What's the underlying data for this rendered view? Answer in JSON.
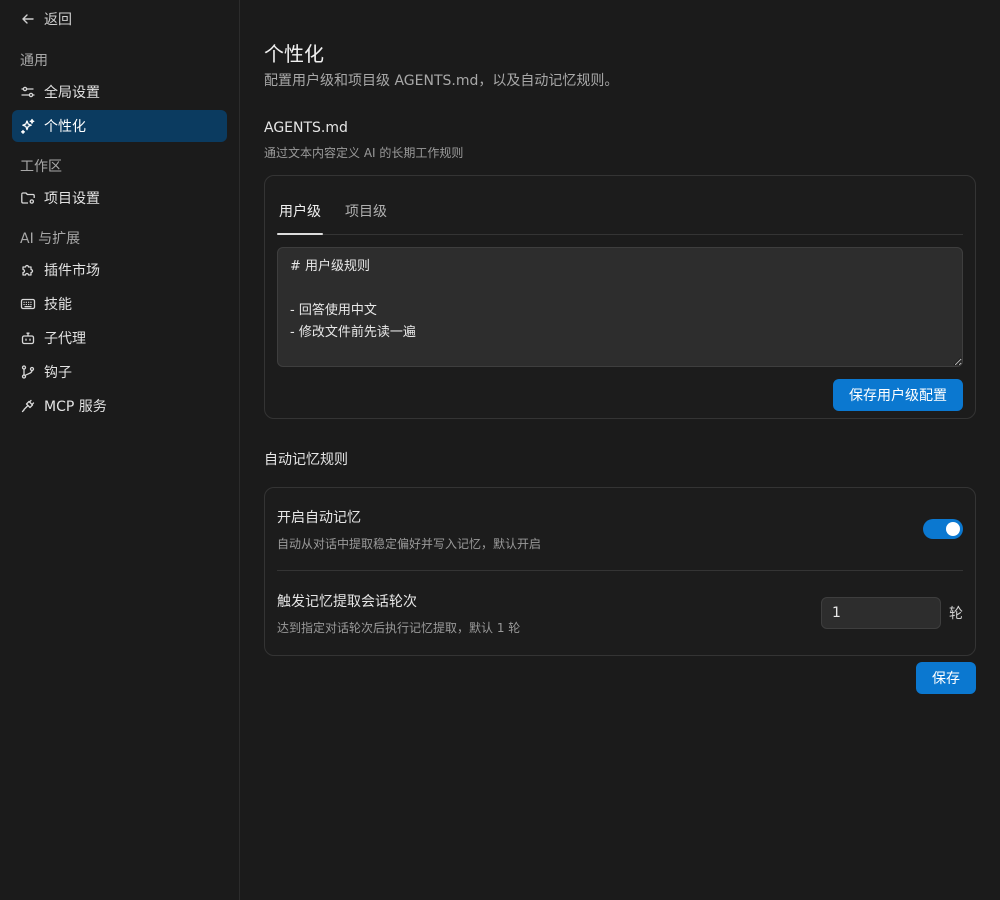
{
  "sidebar": {
    "back_label": "返回",
    "sections": {
      "general": "通用",
      "workspace": "工作区",
      "ai": "AI 与扩展"
    },
    "items": {
      "global_settings": "全局设置",
      "personalization": "个性化",
      "project_settings": "项目设置",
      "plugin_market": "插件市场",
      "skills": "技能",
      "sub_agents": "子代理",
      "hooks": "钩子",
      "mcp": "MCP 服务"
    },
    "active_item": "personalization"
  },
  "page": {
    "title": "个性化",
    "subtitle": "配置用户级和项目级 AGENTS.md，以及自动记忆规则。"
  },
  "agents": {
    "title": "AGENTS.md",
    "subtitle": "通过文本内容定义 AI 的长期工作规则",
    "tabs": [
      "用户级",
      "项目级"
    ],
    "active_tab": 0,
    "editor_value": "# 用户级规则\n\n- 回答使用中文\n- 修改文件前先读一遍",
    "save_label": "保存用户级配置"
  },
  "memory": {
    "title": "自动记忆规则",
    "enable": {
      "label": "开启自动记忆",
      "desc": "自动从对话中提取稳定偏好并写入记忆，默认开启",
      "value": true
    },
    "trigger": {
      "label": "触发记忆提取会话轮次",
      "desc": "达到指定对话轮次后执行记忆提取，默认 1 轮",
      "value": "1",
      "unit": "轮"
    },
    "save_label": "保存"
  },
  "colors": {
    "accent": "#0b78d0",
    "active_nav_bg": "#0b3b60",
    "background": "#1b1b1b"
  }
}
